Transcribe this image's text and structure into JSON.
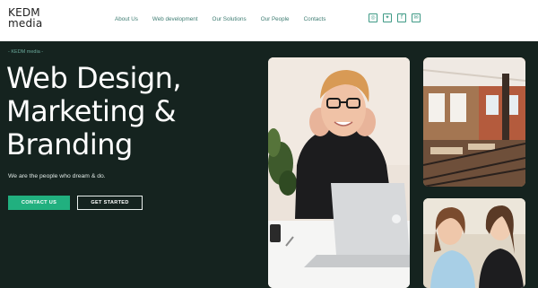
{
  "header": {
    "logo_line1": "KEDM",
    "logo_line2": "media",
    "nav": [
      "About Us",
      "Web development",
      "Our Solutions",
      "Our People",
      "Contacts"
    ],
    "socials": [
      {
        "icon": "instagram-icon",
        "glyph": "◎"
      },
      {
        "icon": "twitter-icon",
        "glyph": "✦"
      },
      {
        "icon": "facebook-icon",
        "glyph": "f"
      },
      {
        "icon": "email-icon",
        "glyph": "✉"
      }
    ]
  },
  "hero": {
    "breadcrumb": "- KEDM media -",
    "headline_lines": [
      "Web Design,",
      "Marketing &",
      "Branding"
    ],
    "tagline": "We are the people who dream & do.",
    "contact_button": "CONTACT US",
    "start_button": "GET STARTED"
  },
  "colors": {
    "background": "#15231f",
    "accent": "#21b07f",
    "nav_text": "#3f7d73"
  }
}
